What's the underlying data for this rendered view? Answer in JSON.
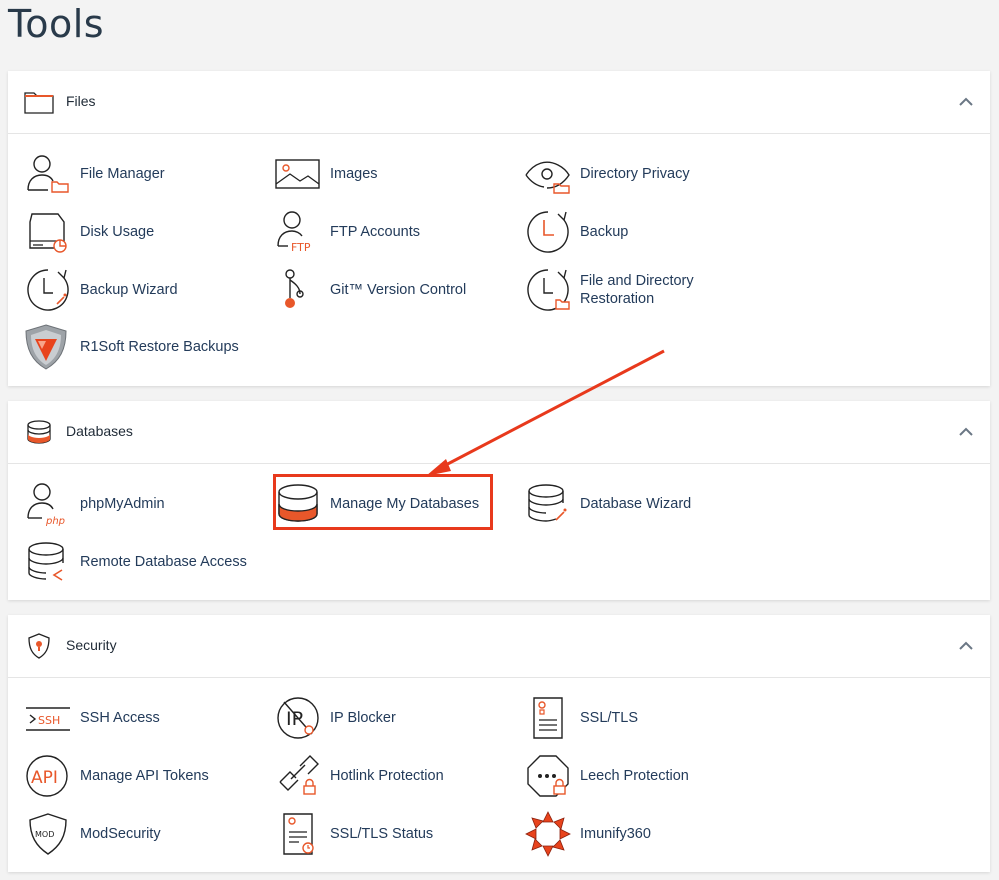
{
  "page": {
    "title": "Tools"
  },
  "colors": {
    "accent": "#e8572a",
    "link": "#233b5a",
    "highlight": "#e8391c"
  },
  "sections": {
    "files": {
      "title": "Files",
      "icon": "folder-icon",
      "items": [
        {
          "label": "File Manager",
          "icon": "file-manager-icon"
        },
        {
          "label": "Images",
          "icon": "images-icon"
        },
        {
          "label": "Directory Privacy",
          "icon": "directory-privacy-icon"
        },
        {
          "label": "Disk Usage",
          "icon": "disk-usage-icon"
        },
        {
          "label": "FTP Accounts",
          "icon": "ftp-accounts-icon"
        },
        {
          "label": "Backup",
          "icon": "backup-icon"
        },
        {
          "label": "Backup Wizard",
          "icon": "backup-wizard-icon"
        },
        {
          "label": "Git™ Version Control",
          "icon": "git-icon"
        },
        {
          "label": "File and Directory Restoration",
          "icon": "restoration-icon"
        },
        {
          "label": "R1Soft Restore Backups",
          "icon": "r1soft-shield-icon"
        }
      ]
    },
    "databases": {
      "title": "Databases",
      "icon": "database-icon",
      "items": [
        {
          "label": "phpMyAdmin",
          "icon": "phpmyadmin-icon"
        },
        {
          "label": "Manage My Databases",
          "icon": "manage-databases-icon"
        },
        {
          "label": "Database Wizard",
          "icon": "database-wizard-icon"
        },
        {
          "label": "Remote Database Access",
          "icon": "remote-database-icon"
        }
      ]
    },
    "security": {
      "title": "Security",
      "icon": "shield-icon",
      "items": [
        {
          "label": "SSH Access",
          "icon": "ssh-icon"
        },
        {
          "label": "IP Blocker",
          "icon": "ip-blocker-icon"
        },
        {
          "label": "SSL/TLS",
          "icon": "ssl-tls-icon"
        },
        {
          "label": "Manage API Tokens",
          "icon": "api-icon"
        },
        {
          "label": "Hotlink Protection",
          "icon": "hotlink-icon"
        },
        {
          "label": "Leech Protection",
          "icon": "leech-icon"
        },
        {
          "label": "ModSecurity",
          "icon": "modsecurity-icon"
        },
        {
          "label": "SSL/TLS Status",
          "icon": "ssl-status-icon"
        },
        {
          "label": "Imunify360",
          "icon": "imunify360-icon"
        }
      ]
    }
  }
}
